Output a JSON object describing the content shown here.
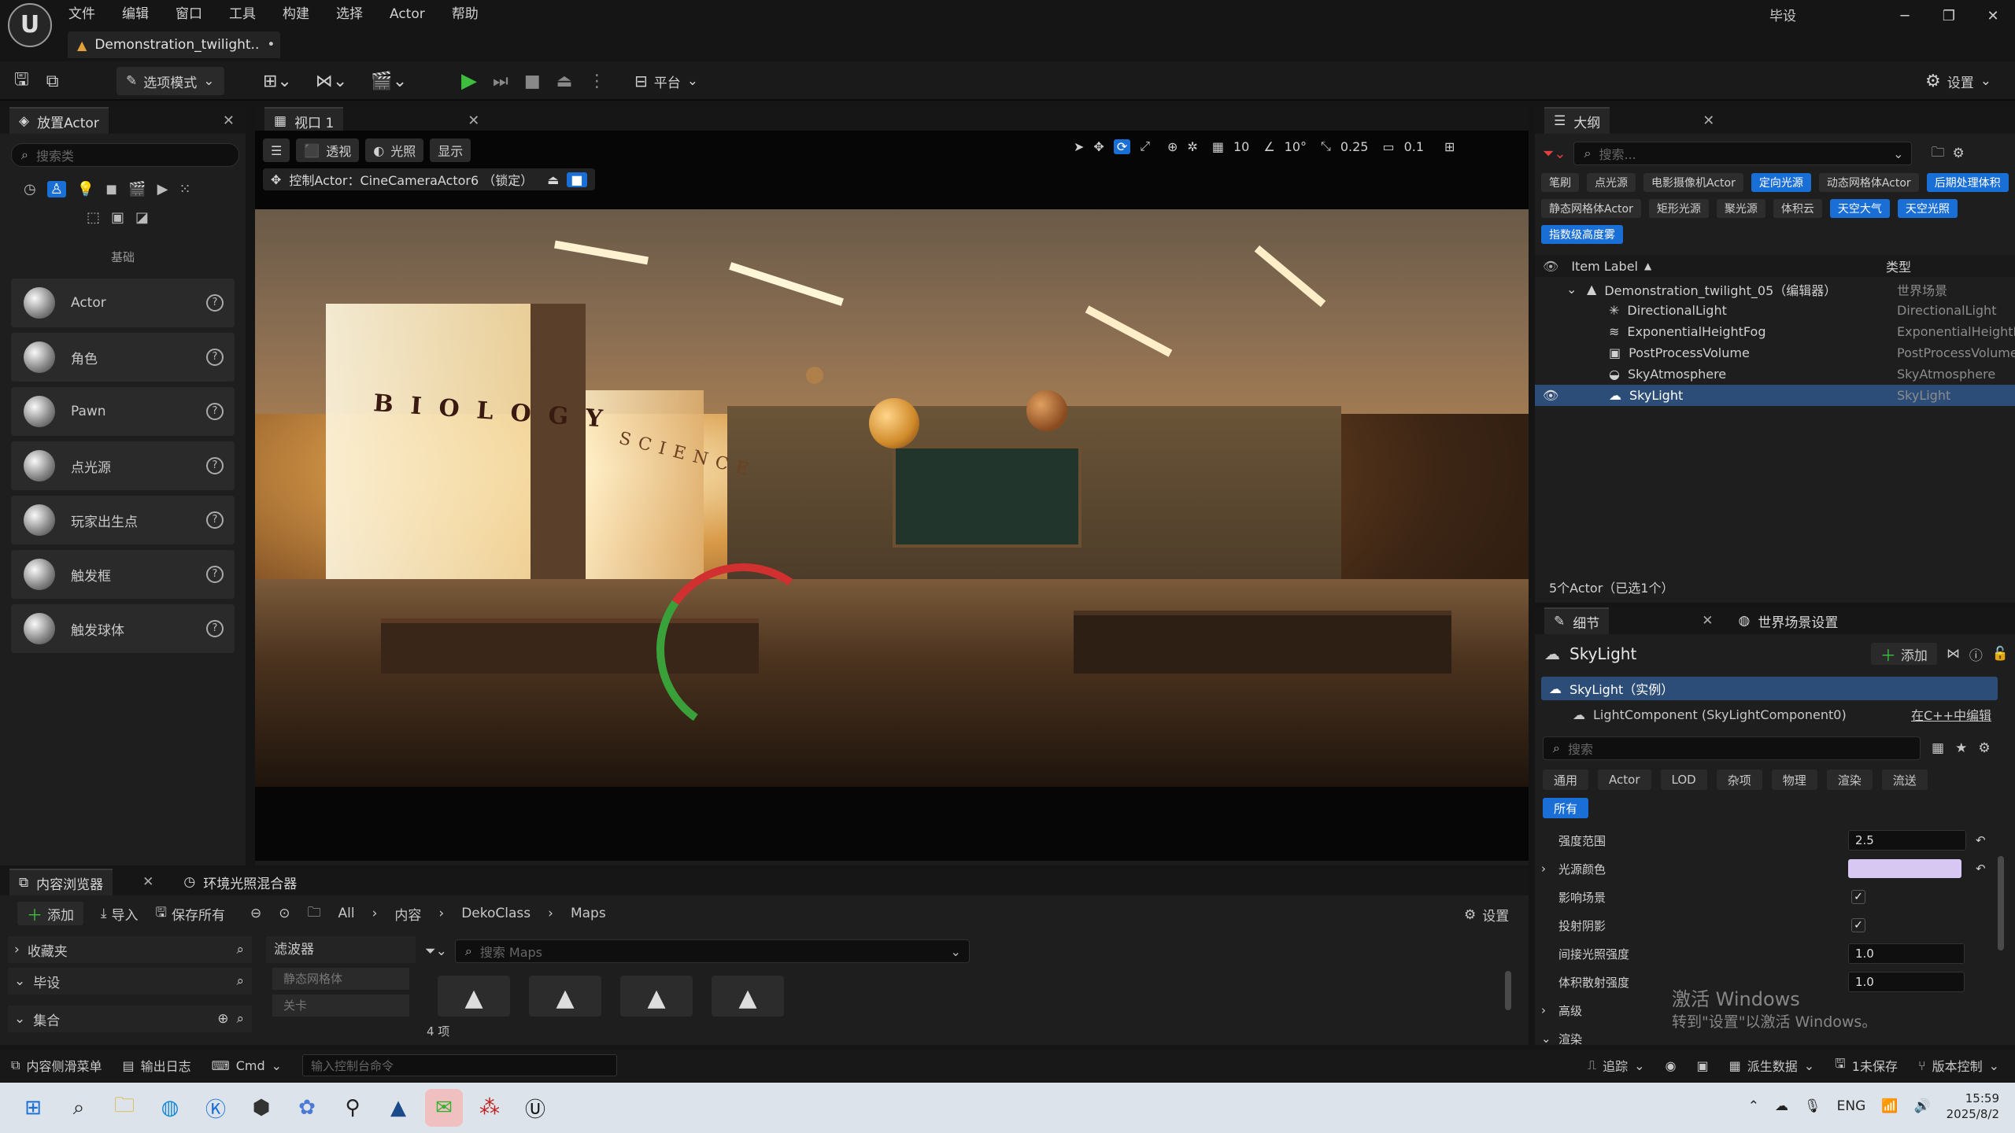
{
  "menu": [
    "文件",
    "编辑",
    "窗口",
    "工具",
    "构建",
    "选择",
    "Actor",
    "帮助"
  ],
  "window": {
    "logo": "U",
    "project": "毕设",
    "doc_tab": "Demonstration_twilight..",
    "doc_modified": "•"
  },
  "toolbar": {
    "mode": "选项模式",
    "platform": "平台",
    "settings": "设置"
  },
  "place_actor": {
    "tab": "放置Actor",
    "search_placeholder": "搜索类",
    "section": "基础",
    "items": [
      {
        "label": "Actor"
      },
      {
        "label": "角色"
      },
      {
        "label": "Pawn"
      },
      {
        "label": "点光源"
      },
      {
        "label": "玩家出生点"
      },
      {
        "label": "触发框"
      },
      {
        "label": "触发球体"
      }
    ]
  },
  "viewport": {
    "tab": "视口 1",
    "perspective": "透视",
    "lit": "光照",
    "show": "显示",
    "pilot": "控制Actor：CineCameraActor6 （锁定）",
    "grid": "10",
    "angle": "10°",
    "scale": "0.25",
    "camspeed": "0.1",
    "scene_text_left": "BIOLOGY",
    "scene_text_right": "SCIENCE"
  },
  "outliner": {
    "tab": "大纲",
    "search_placeholder": "搜索...",
    "filters": [
      {
        "label": "笔刷",
        "on": false
      },
      {
        "label": "点光源",
        "on": false
      },
      {
        "label": "电影摄像机Actor",
        "on": false
      },
      {
        "label": "定向光源",
        "on": true
      },
      {
        "label": "动态网格体Actor",
        "on": false
      },
      {
        "label": "后期处理体积",
        "on": true
      },
      {
        "label": "静态网格体Actor",
        "on": false
      },
      {
        "label": "矩形光源",
        "on": false
      },
      {
        "label": "聚光源",
        "on": false
      },
      {
        "label": "体积云",
        "on": false
      },
      {
        "label": "天空大气",
        "on": true
      },
      {
        "label": "天空光照",
        "on": true
      },
      {
        "label": "指数级高度雾",
        "on": true
      }
    ],
    "col_label": "Item Label",
    "col_type": "类型",
    "rows": [
      {
        "label": "Demonstration_twilight_05（编辑器）",
        "type": "世界场景",
        "icon": "level-icon"
      },
      {
        "label": "DirectionalLight",
        "type": "DirectionalLight",
        "icon": "directional-light-icon"
      },
      {
        "label": "ExponentialHeightFog",
        "type": "ExponentialHeightFog",
        "icon": "fog-icon"
      },
      {
        "label": "PostProcessVolume",
        "type": "PostProcessVolume",
        "icon": "volume-icon"
      },
      {
        "label": "SkyAtmosphere",
        "type": "SkyAtmosphere",
        "icon": "sky-atmosphere-icon"
      },
      {
        "label": "SkyLight",
        "type": "SkyLight",
        "icon": "skylight-icon"
      }
    ],
    "status": "5个Actor（已选1个）"
  },
  "details": {
    "tab": "细节",
    "tab2": "世界场景设置",
    "title": "SkyLight",
    "add": "添加",
    "instance": "SkyLight（实例）",
    "component": "LightComponent (SkyLightComponent0)",
    "edit_cpp": "在C++中编辑",
    "search_placeholder": "搜索",
    "categories": [
      "通用",
      "Actor",
      "LOD",
      "杂项",
      "物理",
      "渲染",
      "流送"
    ],
    "all": "所有",
    "props": [
      {
        "label": "强度范围",
        "value": "2.5",
        "kind": "num",
        "expand": false
      },
      {
        "label": "光源颜色",
        "value": "",
        "kind": "color",
        "expand": true,
        "color": "#d6c8f2"
      },
      {
        "label": "影响场景",
        "value": "✓",
        "kind": "check",
        "expand": false
      },
      {
        "label": "投射阴影",
        "value": "✓",
        "kind": "check",
        "expand": false
      },
      {
        "label": "间接光照强度",
        "value": "1.0",
        "kind": "num",
        "expand": false
      },
      {
        "label": "体积散射强度",
        "value": "1.0",
        "kind": "num",
        "expand": false
      },
      {
        "label": "高级",
        "value": "",
        "kind": "section",
        "expand": true
      },
      {
        "label": "渲染",
        "value": "",
        "kind": "section",
        "expand": true
      }
    ],
    "watermark1": "激活 Windows",
    "watermark2": "转到\"设置\"以激活 Windows。"
  },
  "content_browser": {
    "tab": "内容浏览器",
    "tab2": "环境光照混合器",
    "add": "添加",
    "import": "导入",
    "save_all": "保存所有",
    "path": [
      "All",
      "内容",
      "DekoClass",
      "Maps"
    ],
    "settings": "设置",
    "favorites": "收藏夹",
    "project": "毕设",
    "collections": "集合",
    "filters": "滤波器",
    "filter_items": [
      "静态网格体",
      "关卡"
    ],
    "search_placeholder": "搜索 Maps",
    "count": "4 项"
  },
  "statusbar": {
    "drawer": "内容侧滑菜单",
    "log": "输出日志",
    "cmd": "Cmd",
    "cmd_placeholder": "输入控制台命令",
    "trace": "追踪",
    "derived": "派生数据",
    "unsaved": "1未保存",
    "vc": "版本控制"
  },
  "taskbar": {
    "lang": "ENG",
    "time": "15:59",
    "date": "2025/8/2"
  },
  "colors": {
    "accent": "#1a6fd6",
    "selected_row": "#2c4d78",
    "play": "#3fbd3f"
  }
}
